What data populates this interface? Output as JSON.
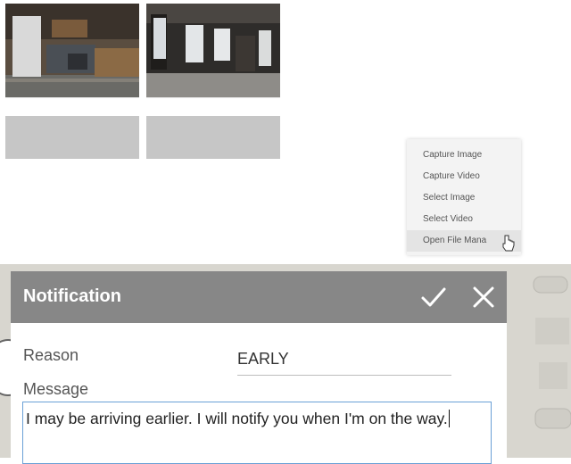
{
  "context_menu": {
    "items": [
      {
        "label": "Capture Image"
      },
      {
        "label": "Capture Video"
      },
      {
        "label": "Select Image"
      },
      {
        "label": "Select Video"
      },
      {
        "label": "Open File Mana"
      }
    ],
    "hovered_index": 4
  },
  "dialog": {
    "title": "Notification",
    "confirm_icon": "checkmark-icon",
    "close_icon": "close-icon",
    "reason_label": "Reason",
    "reason_value": "EARLY",
    "message_label": "Message",
    "message_value": "I may be arriving earlier. I will notify you when I'm on the way."
  },
  "colors": {
    "dialog_header": "#878787",
    "caption_bar": "#c6c6c6",
    "focus_border": "#6aa0d6"
  }
}
